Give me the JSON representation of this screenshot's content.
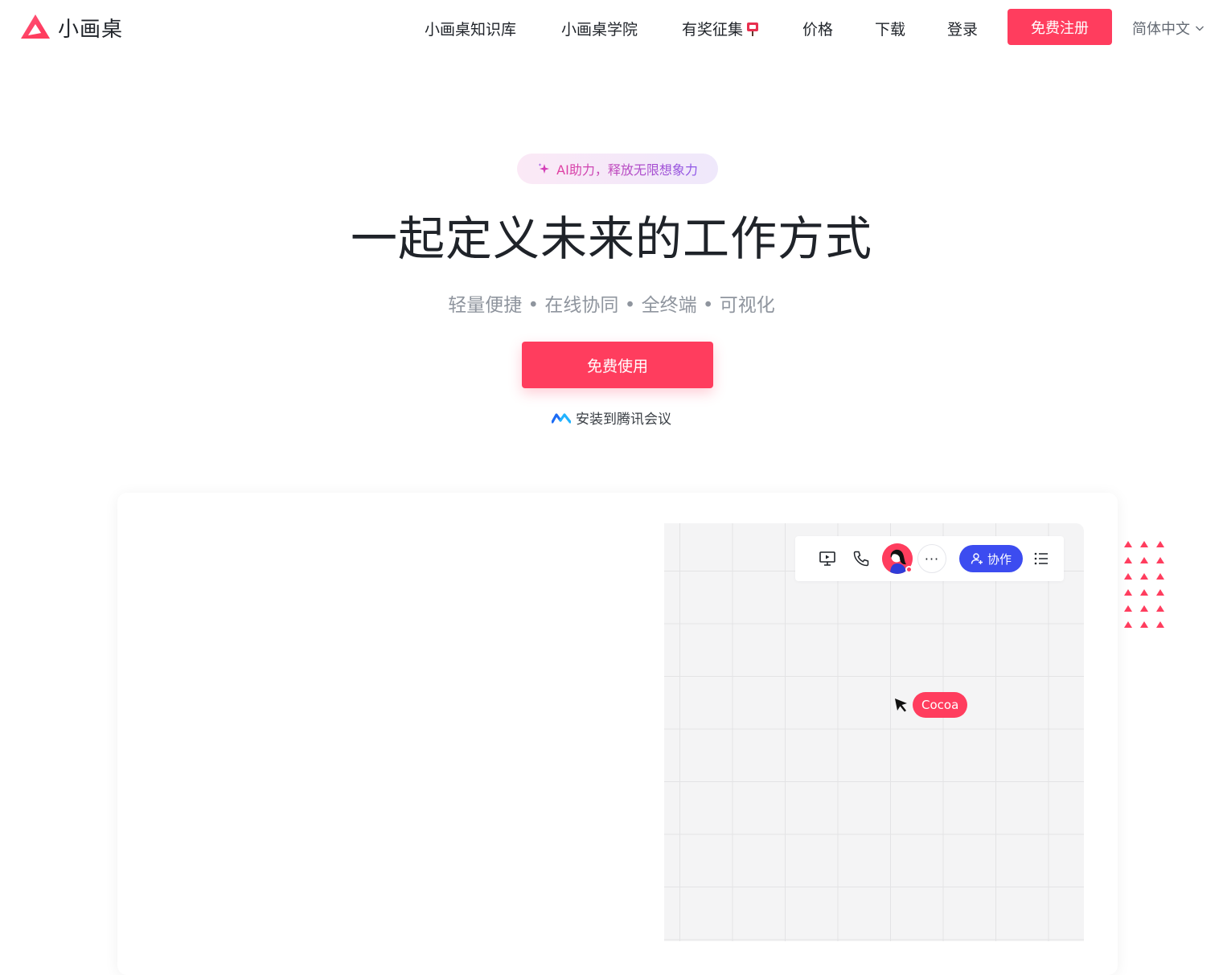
{
  "header": {
    "logo_text": "小画桌",
    "nav": [
      {
        "label": "小画桌知识库"
      },
      {
        "label": "小画桌学院"
      },
      {
        "label": "有奖征集"
      },
      {
        "label": "价格"
      },
      {
        "label": "下载"
      },
      {
        "label": "登录"
      }
    ],
    "signup_label": "免费注册",
    "language": "简体中文"
  },
  "hero": {
    "ai_badge": "AI助力，释放无限想象力",
    "title": "一起定义未来的工作方式",
    "subtitle": "轻量便捷 • 在线协同 • 全终端 • 可视化",
    "cta_label": "免费使用",
    "tencent_link": "安装到腾讯会议"
  },
  "preview": {
    "toolbar": {
      "more_label": "···",
      "collab_label": "协作"
    },
    "cursor_user": "Cocoa"
  },
  "colors": {
    "brand": "#ff3d5e",
    "collab": "#3c4cf0",
    "canvas_bg": "#f4f4f5"
  },
  "icons": [
    "logo-icon",
    "mailbox-icon",
    "chevron-down-icon",
    "sparkle-icon",
    "tencent-meeting-icon",
    "present-icon",
    "phone-icon",
    "user-plus-icon",
    "list-icon",
    "cursor-arrow-icon"
  ]
}
